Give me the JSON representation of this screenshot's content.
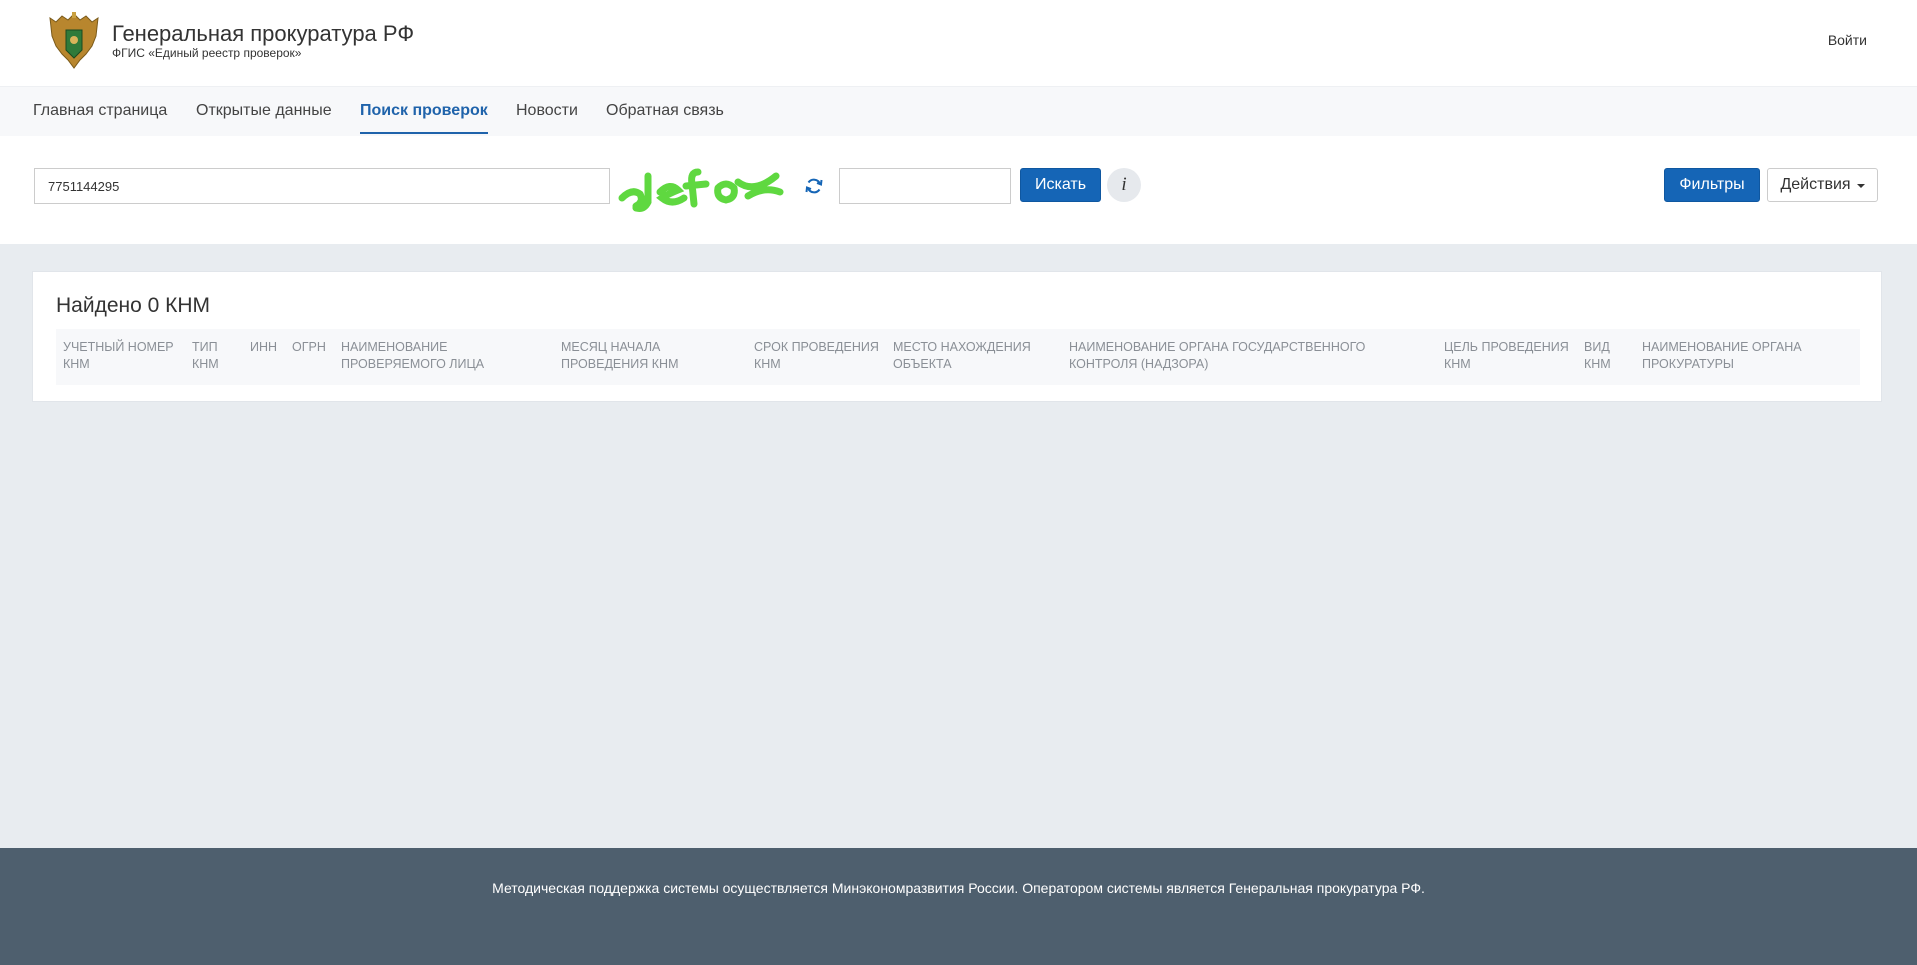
{
  "header": {
    "title": "Генеральная прокуратура РФ",
    "subtitle": "ФГИС «Единый реестр проверок»",
    "login": "Войти"
  },
  "nav": {
    "items": [
      {
        "label": "Главная страница"
      },
      {
        "label": "Открытые данные"
      },
      {
        "label": "Поиск проверок"
      },
      {
        "label": "Новости"
      },
      {
        "label": "Обратная связь"
      }
    ],
    "active_index": 2
  },
  "search": {
    "value": "7751144295",
    "captcha_value": "",
    "search_label": "Искать",
    "info_label": "i",
    "filters_label": "Фильтры",
    "actions_label": "Действия"
  },
  "results": {
    "title": "Найдено 0 КНМ",
    "columns": [
      "УЧЕТНЫЙ НОМЕР КНМ",
      "ТИП КНМ",
      "ИНН",
      "ОГРН",
      "НАИМЕНОВАНИЕ ПРОВЕРЯЕМОГО ЛИЦА",
      "МЕСЯЦ НАЧАЛА ПРОВЕДЕНИЯ КНМ",
      "СРОК ПРОВЕДЕНИЯ КНМ",
      "МЕСТО НАХОЖДЕНИЯ ОБЪЕКТА",
      "НАИМЕНОВАНИЕ ОРГАНА ГОСУДАРСТВЕННОГО КОНТРОЛЯ (НАДЗОРА)",
      "ЦЕЛЬ ПРОВЕДЕНИЯ КНМ",
      "ВИД КНМ",
      "НАИМЕНОВАНИЕ ОРГАНА ПРОКУРАТУРЫ"
    ]
  },
  "footer": {
    "text": "Методическая поддержка системы осуществляется Минэкономразвития России. Оператором системы является Генеральная прокуратура РФ."
  },
  "icons": {
    "logo": "emblem-eagle-icon",
    "captcha": "captcha-image",
    "refresh": "refresh-icon",
    "dropdown": "caret-down-icon"
  },
  "colors": {
    "accent": "#1565b6",
    "active_nav": "#1f63ab",
    "footer_bg": "#4e5f6e",
    "captcha_green": "#5fd840"
  }
}
